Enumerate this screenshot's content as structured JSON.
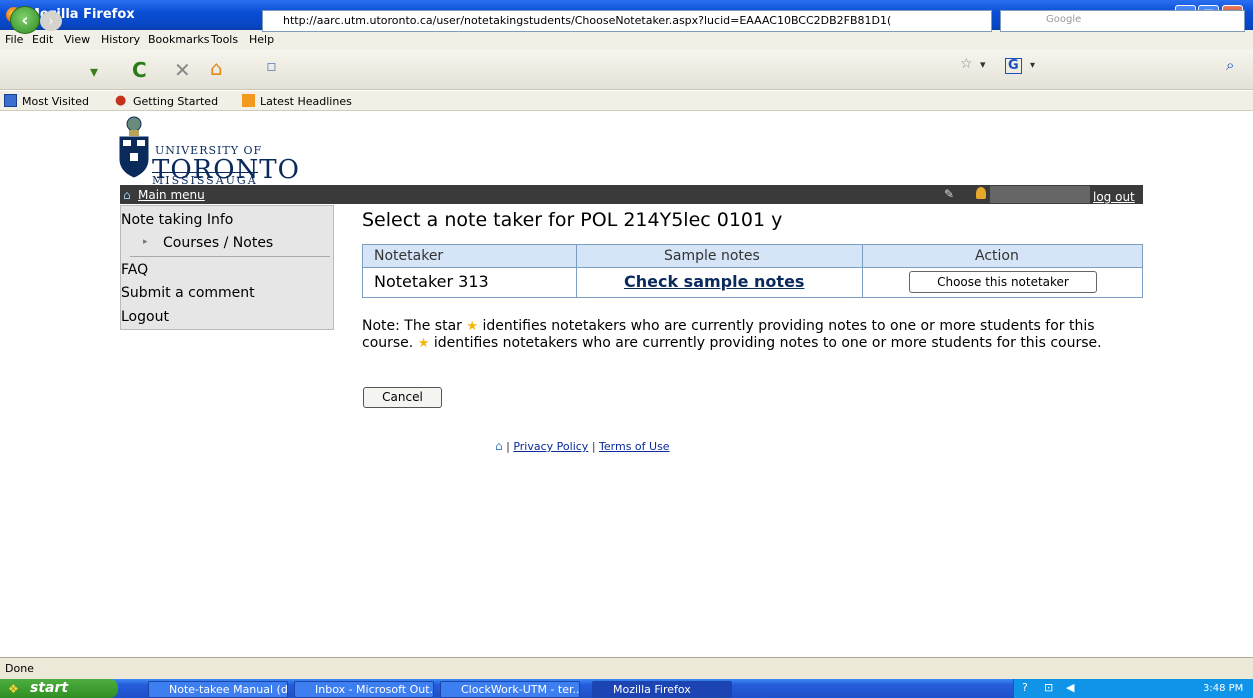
{
  "window": {
    "title": "Mozilla Firefox"
  },
  "menubar": [
    "File",
    "Edit",
    "View",
    "History",
    "Bookmarks",
    "Tools",
    "Help"
  ],
  "navbar": {
    "url": "http://aarc.utm.utoronto.ca/user/notetakingstudents/ChooseNotetaker.aspx?lucid=EAAAC10BCC2DB2FB81D1(",
    "search_placeholder": "Google"
  },
  "bookmarks": [
    "Most Visited",
    "Getting Started",
    "Latest Headlines"
  ],
  "logo": {
    "line1": "UNIVERSITY OF",
    "line2": "TORONTO",
    "line3": "MISSISSAUGA"
  },
  "topbar": {
    "main_menu": "Main menu",
    "logout": "log out"
  },
  "sidebar": {
    "items": [
      "Note taking Info",
      "Courses / Notes",
      "FAQ",
      "Submit a comment",
      "Logout"
    ]
  },
  "main": {
    "heading": "Select a note taker for POL 214Y5lec 0101 y",
    "table": {
      "headers": [
        "Notetaker",
        "Sample notes",
        "Action"
      ],
      "rows": [
        {
          "name": "Notetaker 313",
          "sample": "Check sample notes",
          "action": "Choose this notetaker"
        }
      ]
    },
    "note_a": "Note: The star",
    "note_b": "identifies notetakers who are currently providing notes to one or more students for this course.",
    "note_c": "identifies notetakers who are currently providing notes to one or more students for this course.",
    "cancel": "Cancel"
  },
  "footer": {
    "sep": "|",
    "privacy": "Privacy Policy",
    "terms": "Terms of Use"
  },
  "status": "Done",
  "taskbar": {
    "start": "start",
    "tasks": [
      "Note-takee Manual (d...",
      "Inbox - Microsoft Out...",
      "ClockWork-UTM - ter...",
      "Mozilla Firefox"
    ],
    "clock": "3:48 PM"
  },
  "colors": {
    "accent": "#0a2a5c",
    "titlebar": "#0a4fd6",
    "star": "#f2b90d"
  }
}
